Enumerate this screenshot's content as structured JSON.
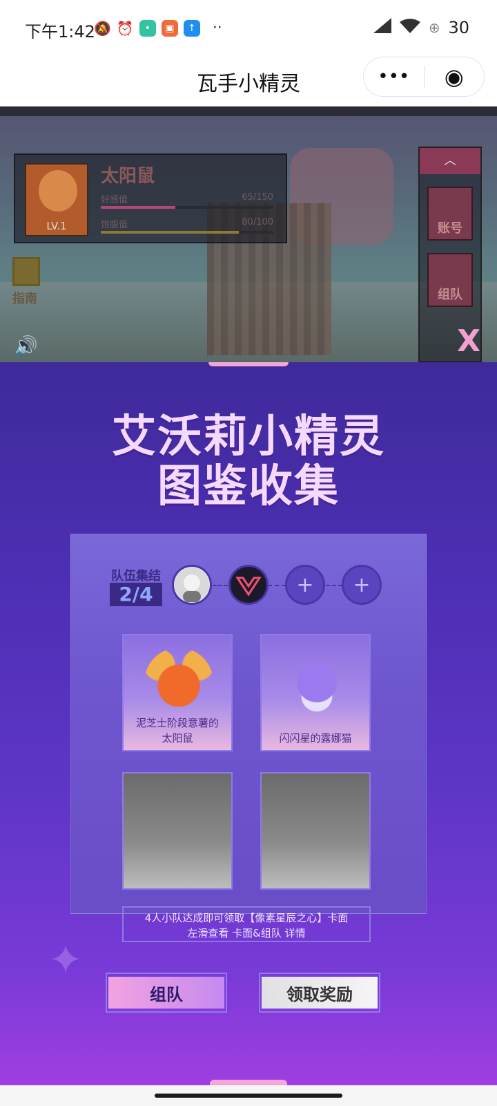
{
  "status_bar": {
    "time": "下午1:42",
    "more": "··",
    "battery": "30",
    "app_colors": [
      "#34c3a0",
      "#f06a3a",
      "#1e8ff0"
    ]
  },
  "title_bar": {
    "title": "瓦手小精灵",
    "menu_glyph": "•••",
    "close_glyph": "◉"
  },
  "game": {
    "pet_name": "太阳鼠",
    "level": "LV.1",
    "stats": [
      {
        "label": "好感值",
        "value": "65/150",
        "ratio": 0.43,
        "color": "#b04876"
      },
      {
        "label": "饱腹值",
        "value": "80/100",
        "ratio": 0.8,
        "color": "#8d7a35"
      }
    ],
    "guide_label": "指南",
    "up_glyph": "︿",
    "account_label": "账号",
    "team_label": "组队",
    "close_x": "X"
  },
  "modal": {
    "title_line1": "艾沃莉小精灵",
    "title_line2": "图鉴收集",
    "team_label": "队伍集结",
    "team_count": "2/4",
    "add_slot_glyph": "+",
    "cards": [
      {
        "caption_line1": "泥芝士阶段意薯的",
        "caption_line2": "太阳鼠",
        "state": "filled",
        "color": "#f06a2a"
      },
      {
        "caption_line1": "闪闪星的露娜猫",
        "caption_line2": "",
        "state": "filled",
        "color": "#9b7af0"
      },
      {
        "caption_line1": "",
        "caption_line2": "",
        "state": "locked"
      },
      {
        "caption_line1": "",
        "caption_line2": "",
        "state": "locked"
      }
    ],
    "notice_line1": "4人小队达成即可领取【像素星辰之心】卡面",
    "notice_line2": "左滑查看 卡面&组队 详情",
    "btn_team": "组队",
    "btn_reward": "领取奖励"
  }
}
